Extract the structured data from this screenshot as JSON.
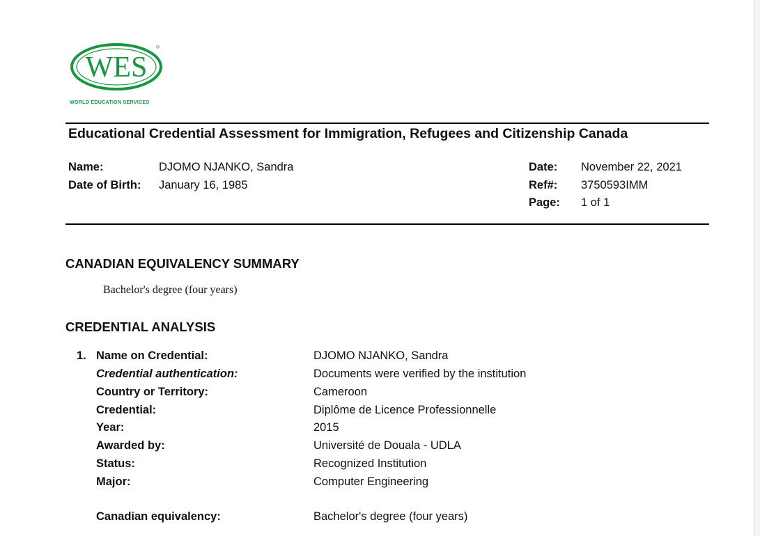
{
  "logo": {
    "wordmark": "WES",
    "subtitle": "WORLD EDUCATION SERVICES",
    "registered_mark": "®",
    "brand_color": "#1a9641"
  },
  "document": {
    "title": "Educational Credential Assessment for Immigration, Refugees and Citizenship Canada"
  },
  "header": {
    "name_label": "Name:",
    "name_value": "DJOMO NJANKO, Sandra",
    "dob_label": "Date of Birth:",
    "dob_value": "January 16, 1985",
    "date_label": "Date:",
    "date_value": "November 22, 2021",
    "ref_label": "Ref#:",
    "ref_value": "3750593IMM",
    "page_label": "Page:",
    "page_value": "1 of 1"
  },
  "summary": {
    "heading": "CANADIAN EQUIVALENCY SUMMARY",
    "text": "Bachelor's degree (four years)"
  },
  "analysis": {
    "heading": "CREDENTIAL ANALYSIS",
    "item_number": "1.",
    "fields": [
      {
        "label": "Name on Credential:",
        "value": "DJOMO NJANKO, Sandra"
      },
      {
        "label": "Credential authentication:",
        "value": "Documents were verified by the institution"
      },
      {
        "label": "Country or Territory:",
        "value": "Cameroon"
      },
      {
        "label": "Credential:",
        "value": "Diplôme de Licence Professionnelle"
      },
      {
        "label": "Year:",
        "value": "2015"
      },
      {
        "label": "Awarded by:",
        "value": "Université de Douala - UDLA"
      },
      {
        "label": "Status:",
        "value": "Recognized Institution"
      },
      {
        "label": "Major:",
        "value": "Computer Engineering"
      },
      {
        "label": "Canadian equivalency:",
        "value": "Bachelor's degree (four years)"
      }
    ]
  }
}
